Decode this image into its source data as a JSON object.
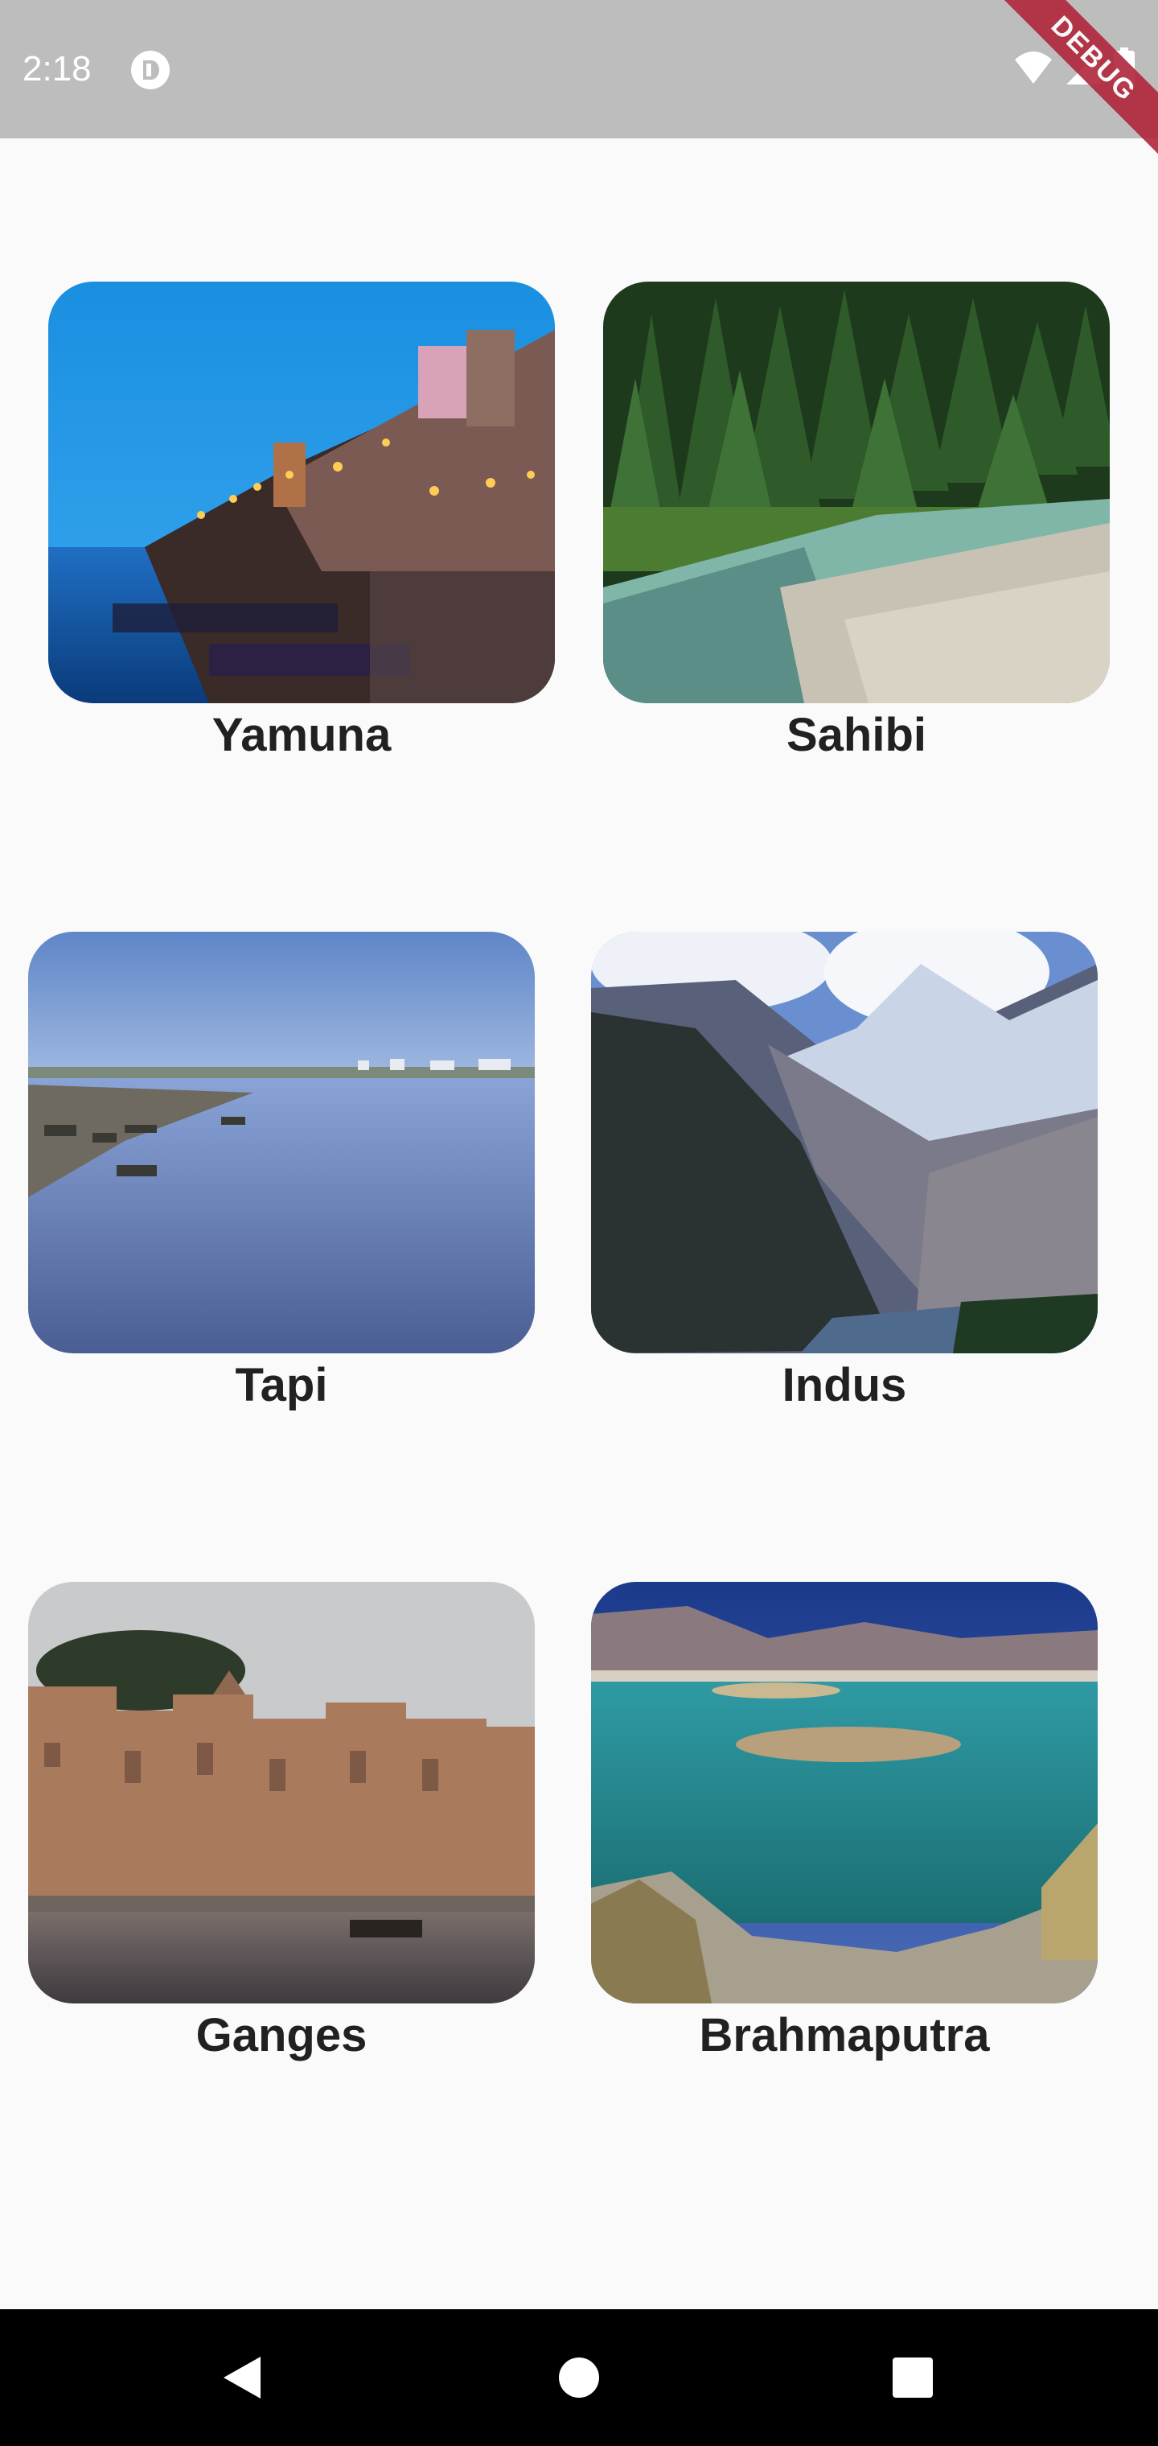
{
  "status_bar": {
    "time": "2:18",
    "icons": [
      "app-notification-icon",
      "wifi-icon",
      "signal-icon",
      "battery-icon"
    ]
  },
  "debug_banner": {
    "label": "DEBUG",
    "color": "#b0263b"
  },
  "rivers": [
    {
      "name": "Yamuna"
    },
    {
      "name": "Sahibi"
    },
    {
      "name": "Tapi"
    },
    {
      "name": "Indus"
    },
    {
      "name": "Ganges"
    },
    {
      "name": "Brahmaputra"
    }
  ],
  "nav_bar": {
    "buttons": [
      "back-icon",
      "home-icon",
      "recents-icon"
    ]
  }
}
